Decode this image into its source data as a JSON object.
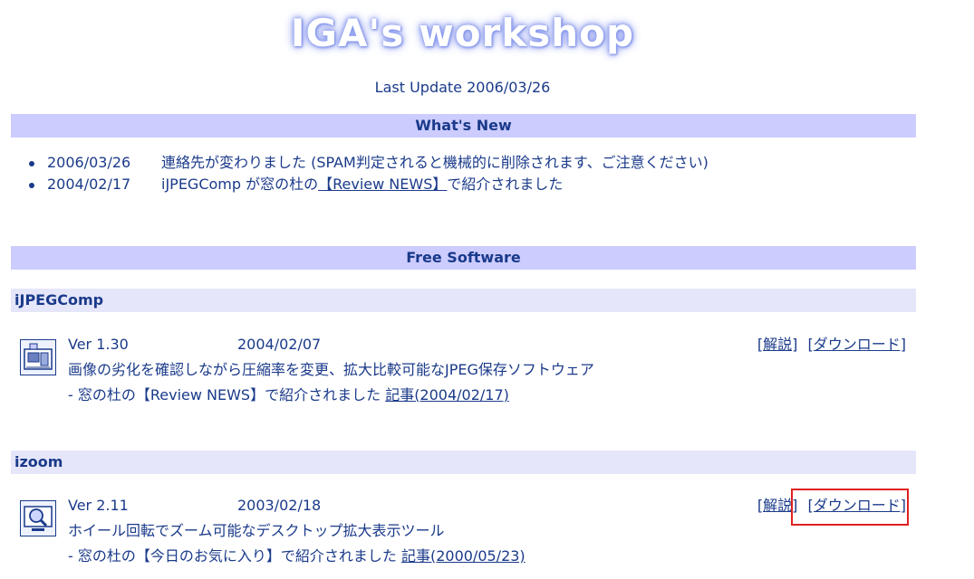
{
  "header": {
    "title": "IGA's workshop",
    "last_update": "Last Update 2006/03/26"
  },
  "whats_new": {
    "heading": "What's New",
    "items": [
      {
        "date": "2006/03/26",
        "text": "連絡先が変わりました (SPAM判定されると機械的に削除されます、ご注意ください)"
      },
      {
        "date": "2004/02/17",
        "text_before": "iJPEGComp が窓の杜の",
        "link": "【Review NEWS】",
        "text_after": "で紹介されました"
      }
    ]
  },
  "free_software": {
    "heading": "Free Software",
    "items": [
      {
        "name": "iJPEGComp",
        "icon": "jpeg-compressor-icon",
        "version": "Ver 1.30",
        "date": "2004/02/07",
        "description": "画像の劣化を確認しながら圧縮率を変更、拡大比較可能なJPEG保存ソフトウェア",
        "reference_text": "- 窓の杜の【Review NEWS】で紹介されました",
        "reference_link": "記事(2004/02/17)",
        "explain_link": "[解説]",
        "download_link": "[ダウンロード]"
      },
      {
        "name": "izoom",
        "icon": "magnifier-icon",
        "version": "Ver 2.11",
        "date": "2003/02/18",
        "description": "ホイール回転でズーム可能なデスクトップ拡大表示ツール",
        "reference_text": "- 窓の杜の【今日のお気に入り】で紹介されました",
        "reference_link": "記事(2000/05/23)",
        "explain_link": "[解説]",
        "download_link": "[ダウンロード]"
      }
    ]
  },
  "colors": {
    "text": "#1a3a8a",
    "section_bar": "#ccccff",
    "sub_bar": "#e6e6fa",
    "highlight": "#e02020"
  }
}
